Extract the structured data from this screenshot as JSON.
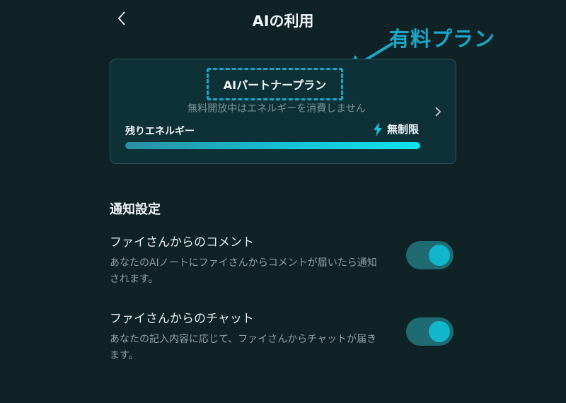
{
  "header": {
    "title": "AIの利用",
    "back_icon": "chevron-left-icon"
  },
  "annotation": {
    "label": "有料プラン",
    "color": "#1aa7c9"
  },
  "plan_card": {
    "plan_name": "AIパートナープラン",
    "note": "無料開放中はエネルギーを消費しません",
    "energy_label": "残りエネルギー",
    "energy_value": "無制限",
    "energy_icon": "lightning-icon",
    "energy_fill_fraction": 1.0
  },
  "notifications": {
    "section_title": "通知設定",
    "items": [
      {
        "title": "ファイさんからのコメント",
        "description": "あなたのAIノートにファイさんからコメントが届いたら通知されます。",
        "enabled": true
      },
      {
        "title": "ファイさんからのチャット",
        "description": "あなたの記入内容に応じて、ファイさんからチャットが届きます。",
        "enabled": true
      }
    ]
  },
  "colors": {
    "background": "#0f2226",
    "accent": "#12b6cc",
    "card": "#0e3138"
  }
}
